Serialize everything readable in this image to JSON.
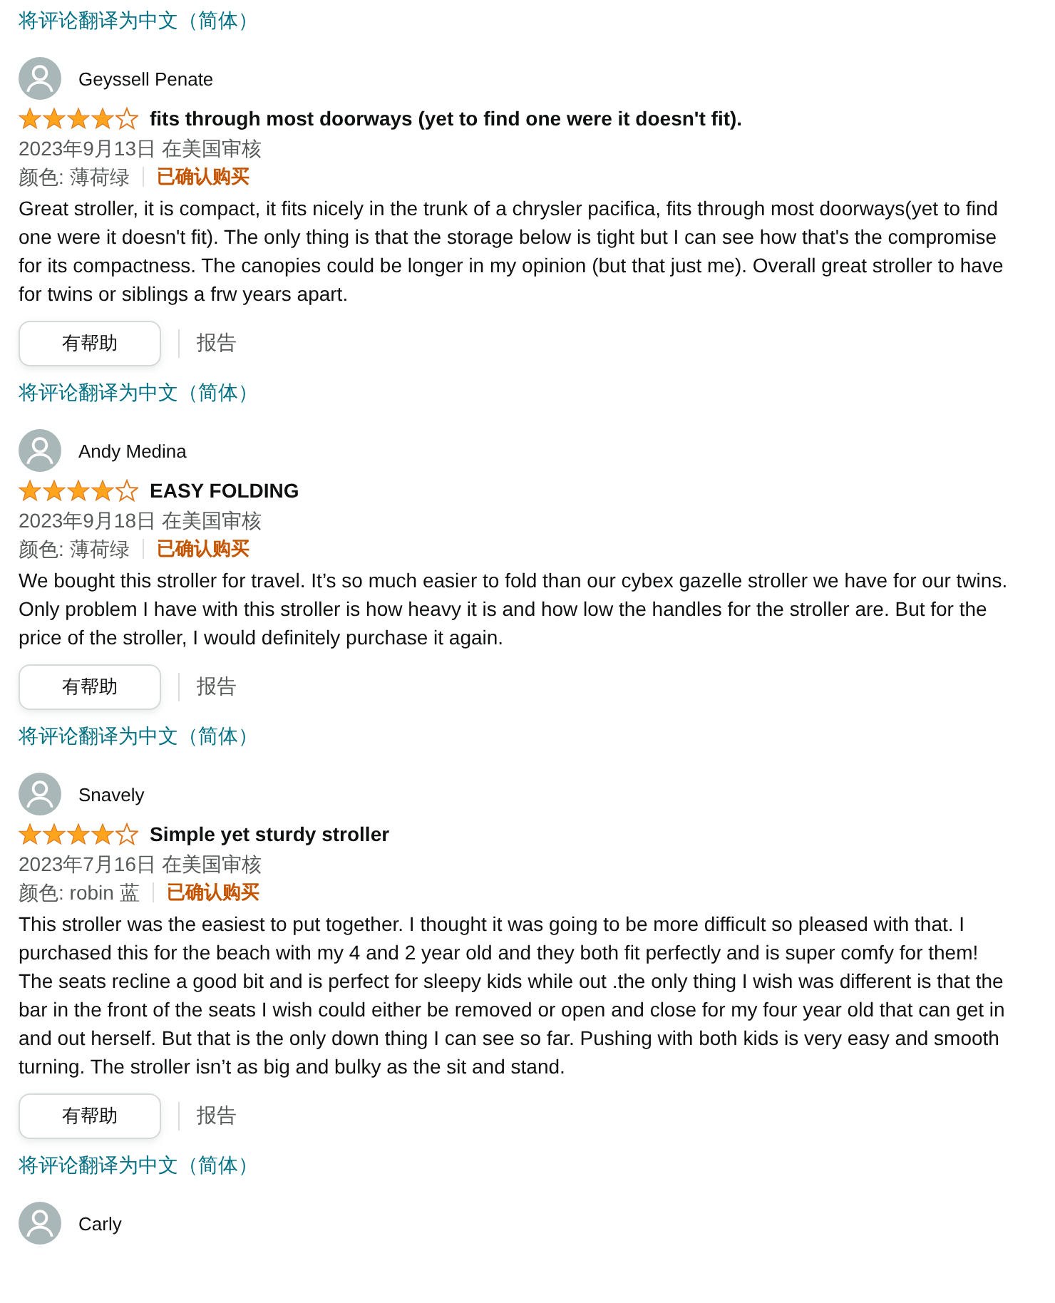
{
  "top_translate_link": "将评论翻译为中文（简体）",
  "reviews": [
    {
      "reviewer": "Geyssell Penate",
      "stars": 4,
      "title": "fits through most doorways (yet to find one were it doesn't fit).",
      "date": "2023年9月13日 在美国审核",
      "variant": "颜色: 薄荷绿",
      "verified": "已确认购买",
      "body": "Great stroller, it is compact, it fits nicely in the trunk of a chrysler pacifica, fits through most doorways(yet to find one were it doesn't fit). The only thing is that the storage below is tight but I can see how that's the compromise for its compactness. The canopies could be longer in my opinion (but that just me). Overall great stroller to have for twins or siblings a frw years apart.",
      "helpful": "有帮助",
      "report": "报告",
      "translate": "将评论翻译为中文（简体）"
    },
    {
      "reviewer": "Andy Medina",
      "stars": 4,
      "title": "EASY FOLDING",
      "date": "2023年9月18日 在美国审核",
      "variant": "颜色: 薄荷绿",
      "verified": "已确认购买",
      "body": "We bought this stroller for travel. It’s so much easier to fold than our cybex gazelle stroller we have for our twins. Only problem I have with this stroller is how heavy it is and how low the handles for the stroller are. But for the price of the stroller, I would definitely purchase it again.",
      "helpful": "有帮助",
      "report": "报告",
      "translate": "将评论翻译为中文（简体）"
    },
    {
      "reviewer": "Snavely",
      "stars": 4,
      "title": "Simple yet sturdy stroller",
      "date": "2023年7月16日 在美国审核",
      "variant": "颜色: robin 蓝",
      "verified": "已确认购买",
      "body": "This stroller was the easiest to put together. I thought it was going to be more difficult so pleased with that. I purchased this for the beach with my 4 and 2 year old and they both fit perfectly and is super comfy for them! The seats recline a good bit and is perfect for sleepy kids while out .the only thing I wish was different is that the bar in the front of the seats I wish could either be removed or open and close for my four year old that can get in and out herself. But that is the only down thing I can see so far. Pushing with both kids is very easy and smooth turning. The stroller isn’t as big and bulky as the sit and stand.",
      "helpful": "有帮助",
      "report": "报告",
      "translate": "将评论翻译为中文（简体）"
    },
    {
      "reviewer": "Carly"
    }
  ]
}
